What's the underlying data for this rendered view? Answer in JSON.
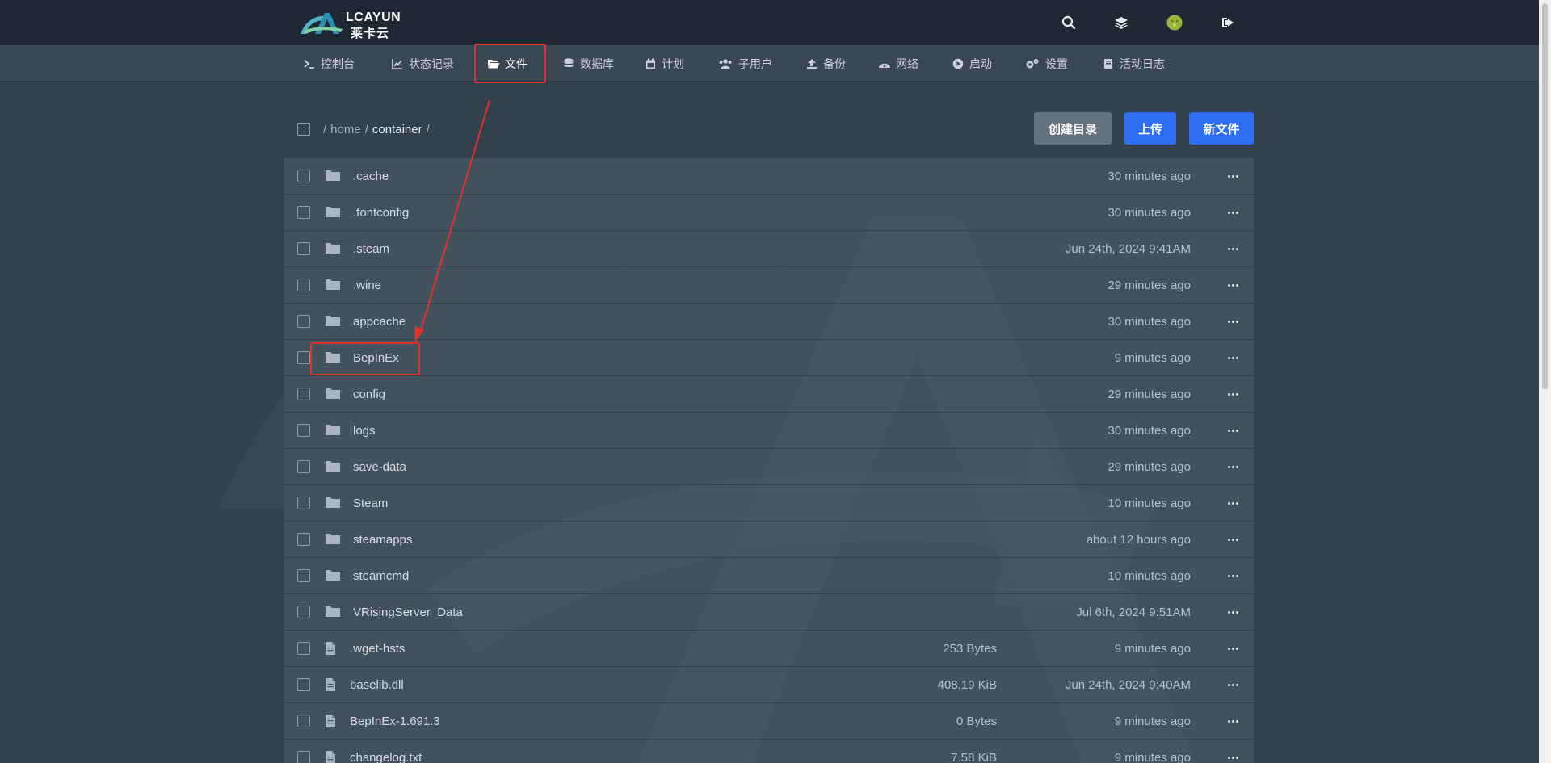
{
  "brand": {
    "name": "LCAYUN",
    "sub": "莱卡云"
  },
  "top_icons": [
    "search-icon",
    "layers-icon",
    "avatar",
    "logout-icon"
  ],
  "nav": [
    {
      "label": "控制台",
      "icon": "terminal-icon"
    },
    {
      "label": "状态记录",
      "icon": "chart-icon"
    },
    {
      "label": "文件",
      "icon": "folder-open-icon",
      "active": true
    },
    {
      "label": "数据库",
      "icon": "database-icon"
    },
    {
      "label": "计划",
      "icon": "calendar-icon"
    },
    {
      "label": "子用户",
      "icon": "users-icon"
    },
    {
      "label": "备份",
      "icon": "upload-icon"
    },
    {
      "label": "网络",
      "icon": "network-icon"
    },
    {
      "label": "启动",
      "icon": "play-icon"
    },
    {
      "label": "设置",
      "icon": "gears-icon"
    },
    {
      "label": "活动日志",
      "icon": "book-icon"
    }
  ],
  "breadcrumb": {
    "sep": "/",
    "home": "home",
    "current": "container"
  },
  "actions": {
    "mkdir": "创建目录",
    "upload": "上传",
    "new_file": "新文件"
  },
  "files": [
    {
      "name": ".cache",
      "type": "folder",
      "size": "",
      "date": "30 minutes ago"
    },
    {
      "name": ".fontconfig",
      "type": "folder",
      "size": "",
      "date": "30 minutes ago"
    },
    {
      "name": ".steam",
      "type": "folder",
      "size": "",
      "date": "Jun 24th, 2024 9:41AM"
    },
    {
      "name": ".wine",
      "type": "folder",
      "size": "",
      "date": "29 minutes ago"
    },
    {
      "name": "appcache",
      "type": "folder",
      "size": "",
      "date": "30 minutes ago"
    },
    {
      "name": "BepInEx",
      "type": "folder",
      "size": "",
      "date": "9 minutes ago"
    },
    {
      "name": "config",
      "type": "folder",
      "size": "",
      "date": "29 minutes ago"
    },
    {
      "name": "logs",
      "type": "folder",
      "size": "",
      "date": "30 minutes ago"
    },
    {
      "name": "save-data",
      "type": "folder",
      "size": "",
      "date": "29 minutes ago"
    },
    {
      "name": "Steam",
      "type": "folder",
      "size": "",
      "date": "10 minutes ago"
    },
    {
      "name": "steamapps",
      "type": "folder",
      "size": "",
      "date": "about 12 hours ago"
    },
    {
      "name": "steamcmd",
      "type": "folder",
      "size": "",
      "date": "10 minutes ago"
    },
    {
      "name": "VRisingServer_Data",
      "type": "folder",
      "size": "",
      "date": "Jul 6th, 2024 9:51AM"
    },
    {
      "name": ".wget-hsts",
      "type": "file",
      "size": "253 Bytes",
      "date": "9 minutes ago"
    },
    {
      "name": "baselib.dll",
      "type": "file",
      "size": "408.19 KiB",
      "date": "Jun 24th, 2024 9:40AM"
    },
    {
      "name": "BepInEx-1.691.3",
      "type": "file",
      "size": "0 Bytes",
      "date": "9 minutes ago"
    },
    {
      "name": "changelog.txt",
      "type": "file",
      "size": "7.58 KiB",
      "date": "9 minutes ago"
    }
  ],
  "colors": {
    "accent": "#2d6ff0",
    "annotation": "#e0312d",
    "topbar": "#1f2934",
    "background": "#33404d"
  }
}
